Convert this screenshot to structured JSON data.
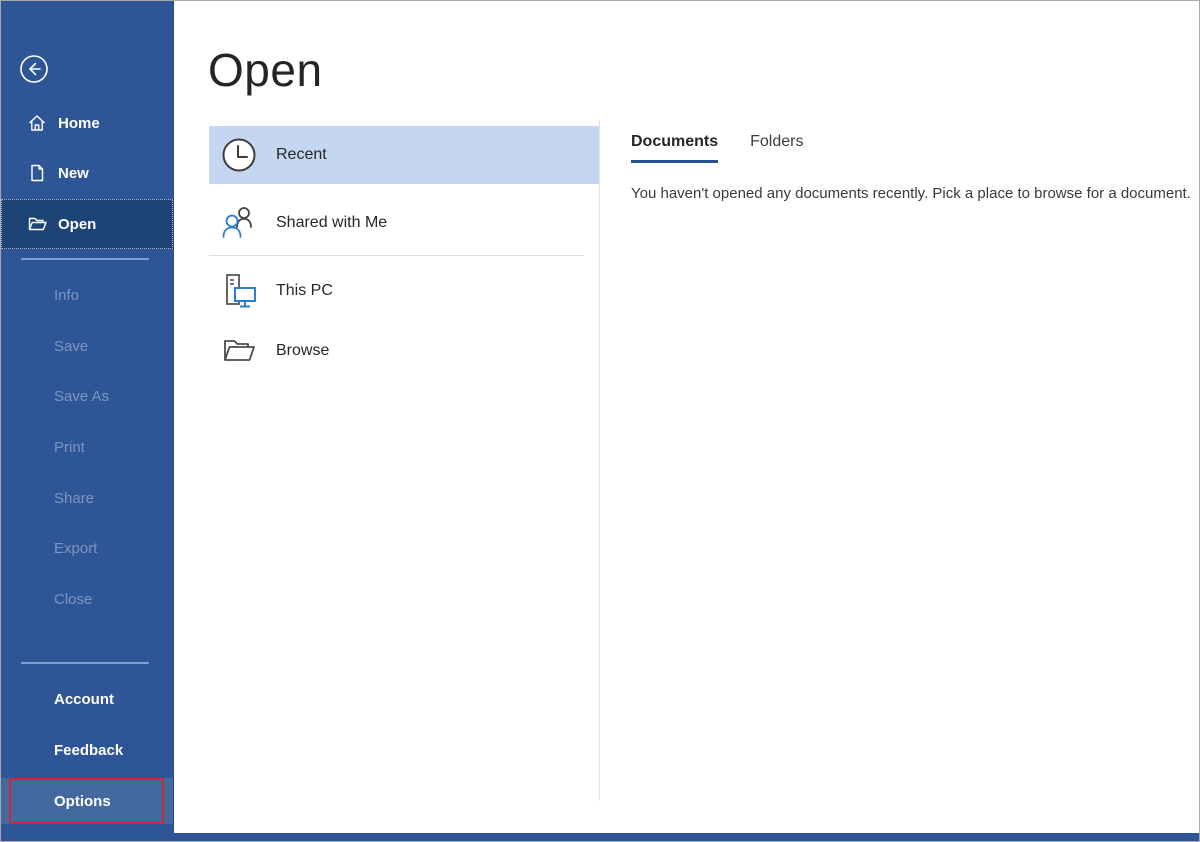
{
  "colors": {
    "sidebar_bg": "#2e5596",
    "sidebar_selected_bg": "#1e4377",
    "sidebar_hover_bg": "#44699f",
    "recent_highlight_bg": "#c5d6f0",
    "tab_underline": "#24508f",
    "callout_red": "#cc2936",
    "icon_blue_accent": "#2b7cd3"
  },
  "sidebar": {
    "top_items": [
      {
        "label": "Home",
        "icon": "home-icon",
        "selected": false
      },
      {
        "label": "New",
        "icon": "new-document-icon",
        "selected": false
      },
      {
        "label": "Open",
        "icon": "open-folder-icon",
        "selected": true
      }
    ],
    "disabled_items": [
      "Info",
      "Save",
      "Save As",
      "Print",
      "Share",
      "Export",
      "Close"
    ],
    "bottom_items": [
      "Account",
      "Feedback",
      "Options"
    ]
  },
  "main": {
    "title": "Open",
    "places": [
      {
        "label": "Recent",
        "icon": "clock-icon",
        "selected": true
      },
      {
        "label": "Shared with Me",
        "icon": "shared-people-icon",
        "selected": false
      },
      {
        "label": "This PC",
        "icon": "this-pc-icon",
        "selected": false
      },
      {
        "label": "Browse",
        "icon": "browse-folder-icon",
        "selected": false
      }
    ]
  },
  "panel": {
    "tabs": [
      {
        "label": "Documents",
        "active": true
      },
      {
        "label": "Folders",
        "active": false
      }
    ],
    "empty_message": "You haven't opened any documents recently. Pick a place to browse for a document."
  }
}
